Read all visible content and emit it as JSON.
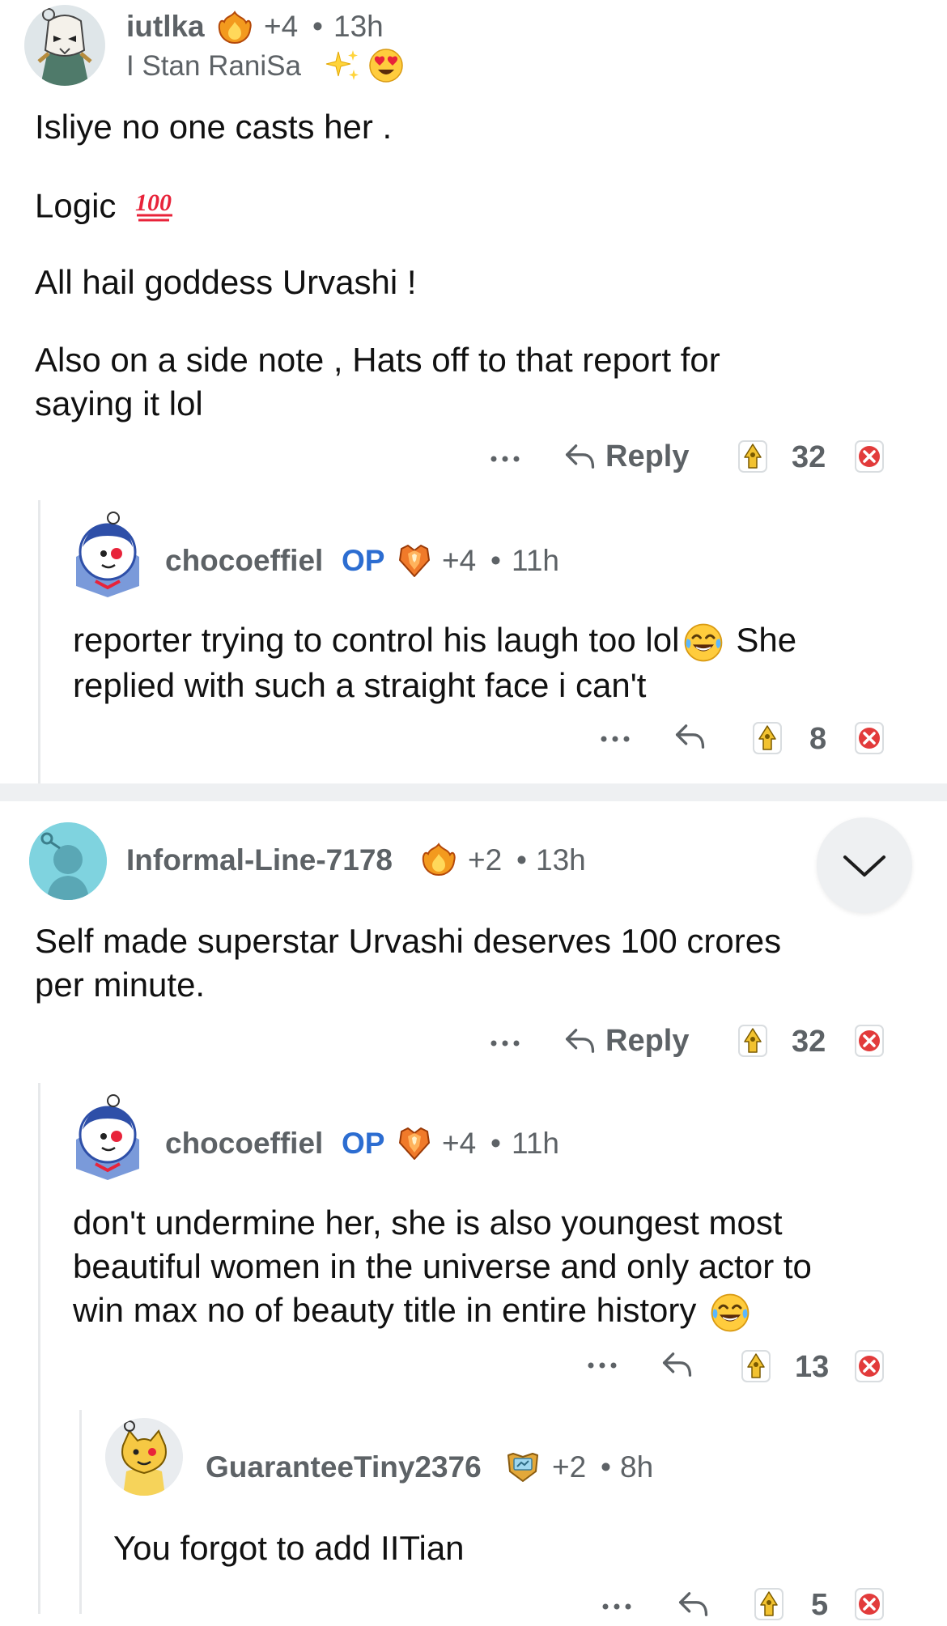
{
  "comments": [
    {
      "username": "iutlka",
      "awards": "+4",
      "time": "13h",
      "flair": "I Stan RaniSa",
      "body": [
        "Isliye no one casts her .",
        "Logic",
        "All hail goddess Urvashi !",
        "Also on a side note , Hats off to that report for",
        "saying it lol"
      ],
      "reply_label": "Reply",
      "votes": "32"
    },
    {
      "username": "chocoeffiel",
      "op_badge": "OP",
      "awards": "+4",
      "time": "11h",
      "body": [
        "reporter trying to control his laugh too lol",
        "She",
        "replied with such a straight face i can't"
      ],
      "votes": "8"
    },
    {
      "username": "Informal-Line-7178",
      "awards": "+2",
      "time": "13h",
      "body": [
        "Self made superstar Urvashi deserves 100 crores",
        "per minute."
      ],
      "reply_label": "Reply",
      "votes": "32"
    },
    {
      "username": "chocoeffiel",
      "op_badge": "OP",
      "awards": "+4",
      "time": "11h",
      "body": [
        "don't undermine her, she is also youngest most",
        "beautiful women in the universe and only actor to",
        "win max no of beauty title in entire history"
      ],
      "votes": "13"
    },
    {
      "username": "GuaranteeTiny2376",
      "awards": "+2",
      "time": "8h",
      "body": [
        "You forgot to add IITian"
      ],
      "votes": "5"
    }
  ],
  "separator": "•",
  "more": "•••",
  "icons": {
    "more": "more-options-icon",
    "reply": "reply-arrow-icon",
    "upvote": "upvote-icon",
    "downvote": "downvote-icon",
    "collapse": "chevron-down-icon",
    "award_fire": "award-fire-icon",
    "award_gem": "award-gem-icon",
    "award_shield": "award-shield-icon",
    "emoji_sparkles": "sparkles-emoji",
    "emoji_heart_eyes": "heart-eyes-emoji",
    "emoji_hundred": "hundred-points-emoji",
    "emoji_laugh": "tears-of-joy-emoji"
  },
  "colors": {
    "op": "#2c6dd1",
    "muted": "#5d6266",
    "upvote": "#e3b21c",
    "downvote": "#e23b3b",
    "divider": "#eef0f2"
  }
}
